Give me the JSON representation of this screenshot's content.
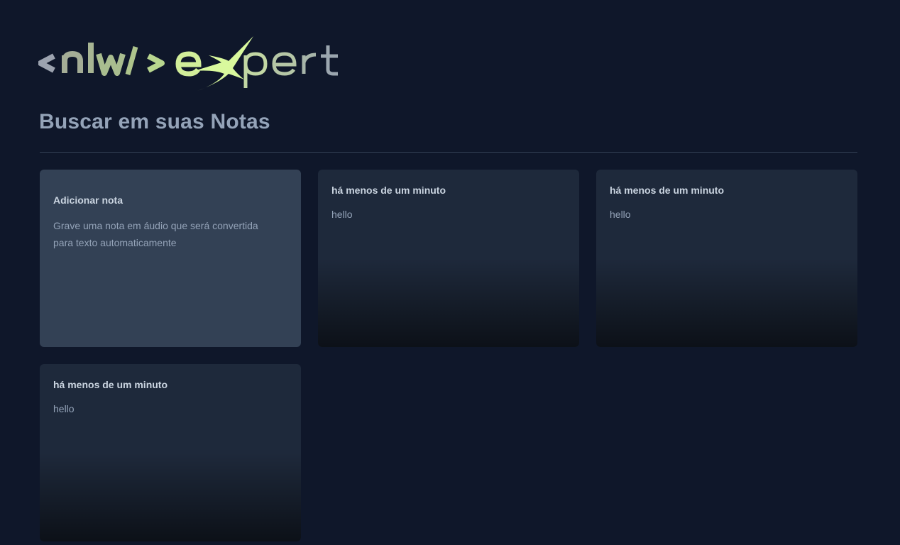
{
  "logo": {
    "label": "<nlw/> expert",
    "colors": {
      "gradient_start": "#9ca3af",
      "gradient_mid": "#a7c78a",
      "accent": "#d9f99d",
      "gradient_end": "#94a3b8"
    }
  },
  "search": {
    "placeholder": "Buscar em suas Notas",
    "value": ""
  },
  "add_card": {
    "title": "Adicionar nota",
    "description": "Grave uma nota em áudio que será convertida para texto automaticamente"
  },
  "notes": [
    {
      "date": "há menos de um minuto",
      "content": "hello"
    },
    {
      "date": "há menos de um minuto",
      "content": "hello"
    },
    {
      "date": "há menos de um minuto",
      "content": "hello"
    }
  ],
  "colors": {
    "background": "#0f172a",
    "card": "#1e293b",
    "add_card": "#334155",
    "title_text": "#cbd5e1",
    "body_text": "#94a3b8"
  }
}
